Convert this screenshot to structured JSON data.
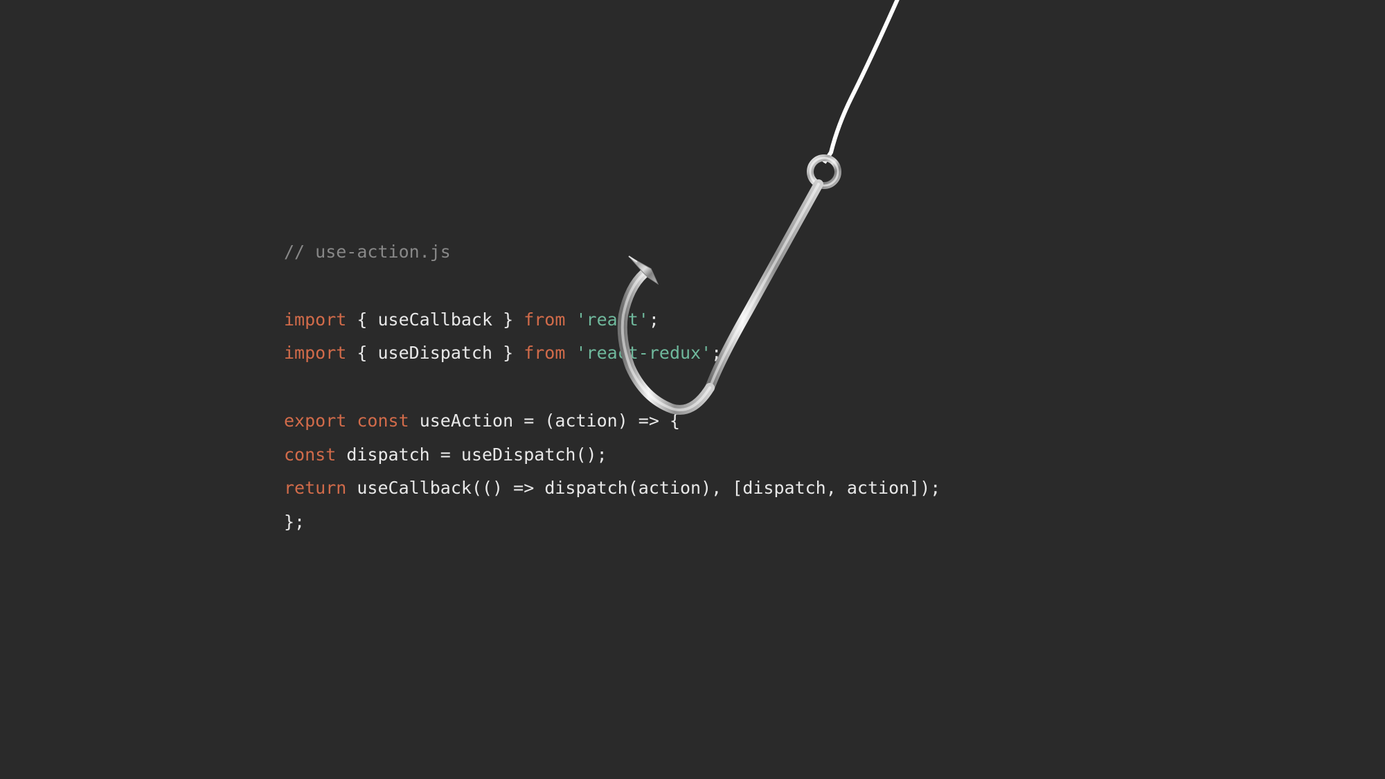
{
  "code": {
    "comment": "// use-action.js",
    "line1": {
      "kw1": "import",
      "p1": " { ",
      "id1": "useCallback",
      "p2": " } ",
      "kw2": "from",
      "sp": " ",
      "str": "'react'",
      "p3": ";"
    },
    "line2": {
      "kw1": "import",
      "p1": " { ",
      "id1": "useDispatch",
      "p2": " } ",
      "kw2": "from",
      "sp": " ",
      "str": "'react-redux'",
      "p3": ";"
    },
    "line3": {
      "kw1": "export",
      "sp1": " ",
      "kw2": "const",
      "sp2": " ",
      "id1": "useAction",
      "p1": " = (",
      "id2": "action",
      "p2": ") => {"
    },
    "line4": {
      "indent": " ",
      "kw1": "const",
      "sp": " ",
      "id1": "dispatch",
      "p1": " = ",
      "id2": "useDispatch",
      "p2": "();"
    },
    "line5": {
      "indent": " ",
      "kw1": "return",
      "sp": " ",
      "id1": "useCallback",
      "p1": "(() => ",
      "id2": "dispatch",
      "p2": "(",
      "id3": "action",
      "p3": "), [",
      "id4": "dispatch",
      "p4": ", ",
      "id5": "action",
      "p5": "]);"
    },
    "line6": {
      "p": "};"
    }
  },
  "colors": {
    "bg": "#2a2a2a",
    "comment": "#888888",
    "keyword": "#d16b4a",
    "identifier": "#e8e8e8",
    "string": "#6fb89c"
  },
  "decoration": "fish-hook"
}
